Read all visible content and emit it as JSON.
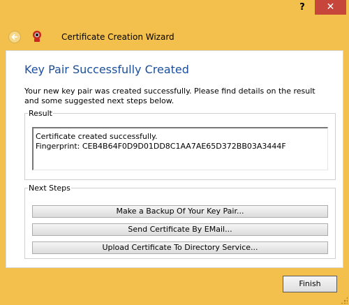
{
  "titlebar": {
    "help_label": "?",
    "close_label": "✕"
  },
  "header": {
    "back_icon": "back-arrow-icon",
    "app_icon": "certificate-app-icon",
    "title": "Certificate Creation Wizard"
  },
  "page": {
    "title": "Key Pair Successfully Created",
    "description": "Your new key pair was created successfully. Please find details on the result and some suggested next steps below."
  },
  "result": {
    "legend": "Result",
    "line1": "Certificate created successfully.",
    "line2": "Fingerprint: CEB4B64F0D9D01DD8C1AA7AE65D372BB03A3444F"
  },
  "next_steps": {
    "legend": "Next Steps",
    "buttons": [
      {
        "label": "Make a Backup Of Your Key Pair..."
      },
      {
        "label": "Send Certificate By EMail..."
      },
      {
        "label": "Upload Certificate To Directory Service..."
      }
    ]
  },
  "footer": {
    "finish_label": "Finish"
  },
  "colors": {
    "frame": "#f3c04d",
    "title_blue": "#1a4e9c",
    "close_red": "#c7463b"
  }
}
